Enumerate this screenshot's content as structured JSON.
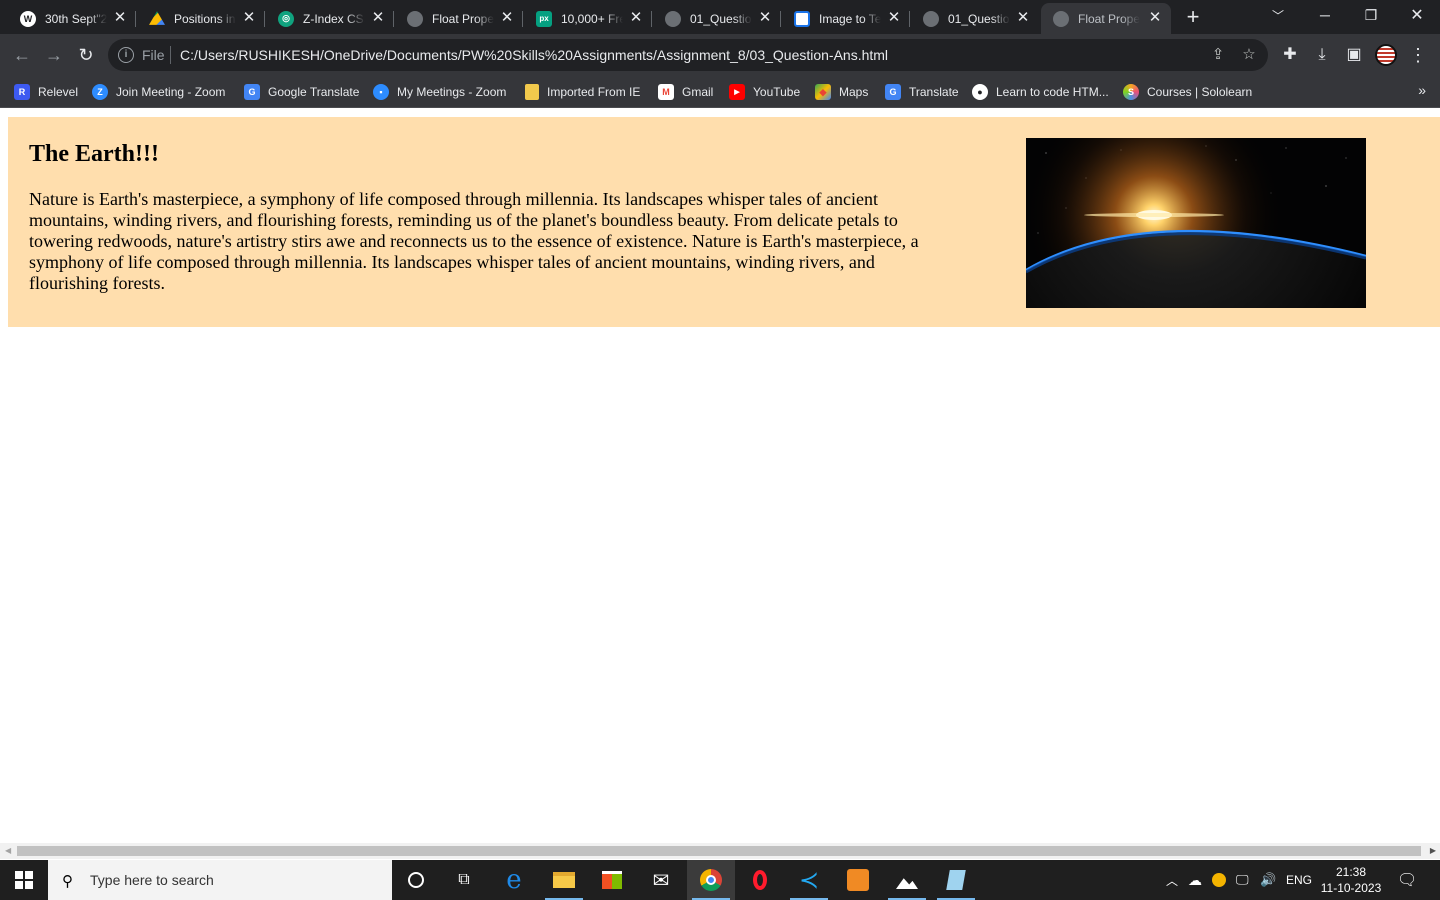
{
  "browser": {
    "tabs": [
      {
        "title": "30th Sept\"2",
        "icon": "wordpress-icon",
        "color": "#ffffff"
      },
      {
        "title": "Positions in",
        "icon": "drive-icon",
        "color": "#fbbc04"
      },
      {
        "title": "Z-Index CSS",
        "icon": "openai-icon",
        "color": "#10a37f"
      },
      {
        "title": "Float Prope",
        "icon": "globe-icon",
        "color": "#9aa0a6"
      },
      {
        "title": "10,000+ Fre",
        "icon": "pexels-icon",
        "color": "#05a081"
      },
      {
        "title": "01_Questio",
        "icon": "globe-icon",
        "color": "#9aa0a6"
      },
      {
        "title": "Image to Te",
        "icon": "image-to-text-icon",
        "color": "#1a73e8"
      },
      {
        "title": "01_Questio",
        "icon": "globe-icon",
        "color": "#9aa0a6"
      },
      {
        "title": "Float Prope",
        "icon": "globe-icon",
        "color": "#9aa0a6"
      }
    ],
    "address": {
      "scheme": "File",
      "url": "C:/Users/RUSHIKESH/OneDrive/Documents/PW%20Skills%20Assignments/Assignment_8/03_Question-Ans.html"
    },
    "bookmarks": [
      {
        "label": "Relevel",
        "icon": "relevel-icon",
        "color": "#3d5af1",
        "glyph": "R"
      },
      {
        "label": "Join Meeting - Zoom",
        "icon": "zoom-icon",
        "color": "#2d8cff",
        "glyph": "Z"
      },
      {
        "label": "Google Translate",
        "icon": "translate-icon",
        "color": "#4285f4",
        "glyph": "G"
      },
      {
        "label": "My Meetings - Zoom",
        "icon": "zoom-icon",
        "color": "#2d8cff",
        "glyph": "▪"
      },
      {
        "label": "Imported From IE",
        "icon": "folder-icon",
        "color": "#f2c94c",
        "glyph": ""
      },
      {
        "label": "Gmail",
        "icon": "gmail-icon",
        "color": "#ea4335",
        "glyph": "M"
      },
      {
        "label": "YouTube",
        "icon": "youtube-icon",
        "color": "#ff0000",
        "glyph": "▶"
      },
      {
        "label": "Maps",
        "icon": "maps-icon",
        "color": "#34a853",
        "glyph": "◆"
      },
      {
        "label": "Translate",
        "icon": "translate-icon",
        "color": "#4285f4",
        "glyph": "G"
      },
      {
        "label": "Learn to code HTM...",
        "icon": "freecodecamp-icon",
        "color": "#ffffff",
        "glyph": "●"
      },
      {
        "label": "Courses | Sololearn",
        "icon": "sololearn-icon",
        "color": "#f5a623",
        "glyph": "S"
      }
    ]
  },
  "page": {
    "heading": "The Earth!!!",
    "paragraph": "Nature is Earth's masterpiece, a symphony of life composed through millennia. Its landscapes whisper tales of ancient mountains, winding rivers, and flourishing forests, reminding us of the planet's boundless beauty. From delicate petals to towering redwoods, nature's artistry stirs awe and reconnects us to the essence of existence. Nature is Earth's masterpiece, a symphony of life composed through millennia. Its landscapes whisper tales of ancient mountains, winding rivers, and flourishing forests.",
    "background": "#ffdead"
  },
  "taskbar": {
    "search_placeholder": "Type here to search",
    "apps": [
      "cortana-icon",
      "task-view-icon",
      "edge-icon",
      "file-explorer-icon",
      "store-icon",
      "mail-icon",
      "chrome-icon",
      "opera-icon",
      "vscode-icon",
      "sublime-icon",
      "photos-icon",
      "notepad-icon"
    ],
    "language": "ENG",
    "time": "21:38",
    "date": "11-10-2023"
  }
}
